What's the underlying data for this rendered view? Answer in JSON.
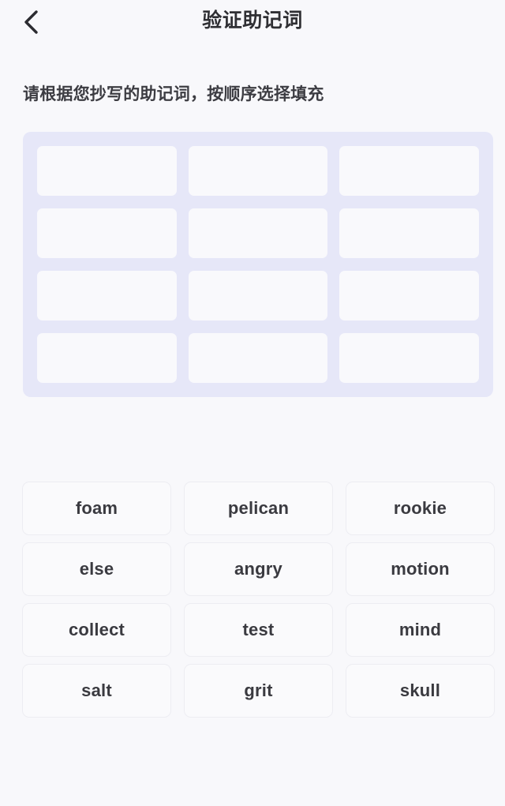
{
  "header": {
    "title": "验证助记词",
    "back_icon": "chevron-left-icon"
  },
  "instruction": "请根据您抄写的助记词，按顺序选择填充",
  "slots": {
    "count": 12,
    "rows": 4,
    "columns": 3,
    "values": [
      "",
      "",
      "",
      "",
      "",
      "",
      "",
      "",
      "",
      "",
      "",
      ""
    ],
    "panel_color": "#e6e7f8",
    "slot_color": "#f9f9fc"
  },
  "word_choices": {
    "rows": 4,
    "columns": 3,
    "words": [
      "foam",
      "pelican",
      "rookie",
      "else",
      "angry",
      "motion",
      "collect",
      "test",
      "mind",
      "salt",
      "grit",
      "skull"
    ]
  },
  "colors": {
    "background": "#f8f8fb",
    "text_primary": "#2f2f33",
    "text_secondary": "#3c3c42",
    "word_text": "#3a3a40",
    "word_border": "#ededf2",
    "word_fill": "#fafafc"
  }
}
